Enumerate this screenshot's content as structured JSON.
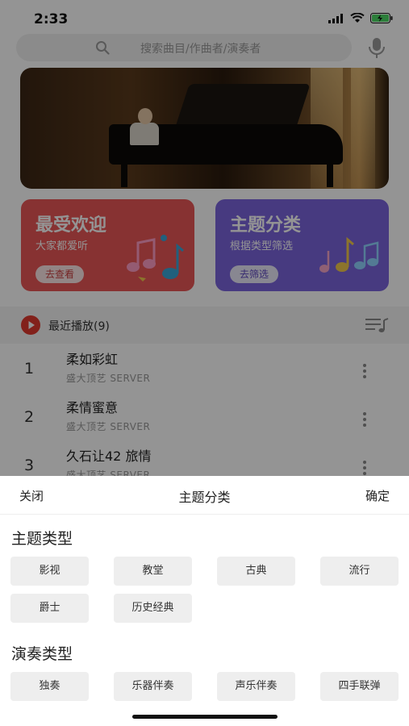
{
  "status_bar": {
    "time": "2:33"
  },
  "search": {
    "placeholder": "搜索曲目/作曲者/演奏者"
  },
  "cards": [
    {
      "title": "最受欢迎",
      "subtitle": "大家都爱听",
      "button": "去查看",
      "color": "#e85656"
    },
    {
      "title": "主题分类",
      "subtitle": "根据类型筛选",
      "button": "去筛选",
      "color": "#7a64dd"
    }
  ],
  "recent": {
    "label": "最近播放(9)"
  },
  "songs": [
    {
      "index": "1",
      "title": "柔如彩虹",
      "meta": "盛大顶艺  SERVER"
    },
    {
      "index": "2",
      "title": "柔情蜜意",
      "meta": "盛大顶艺  SERVER"
    },
    {
      "index": "3",
      "title": "久石让42 旅情",
      "meta": "盛大顶艺  SERVER"
    }
  ],
  "sheet": {
    "close": "关闭",
    "title": "主题分类",
    "confirm": "确定",
    "theme_section": {
      "title": "主题类型",
      "options": [
        "影视",
        "教堂",
        "古典",
        "流行",
        "爵士",
        "历史经典"
      ]
    },
    "performance_section": {
      "title": "演奏类型",
      "options": [
        "独奏",
        "乐器伴奏",
        "声乐伴奏",
        "四手联弹"
      ]
    }
  },
  "colors": {
    "accent_red": "#e85656",
    "accent_purple": "#7a64dd",
    "play_red": "#e03a2f"
  }
}
